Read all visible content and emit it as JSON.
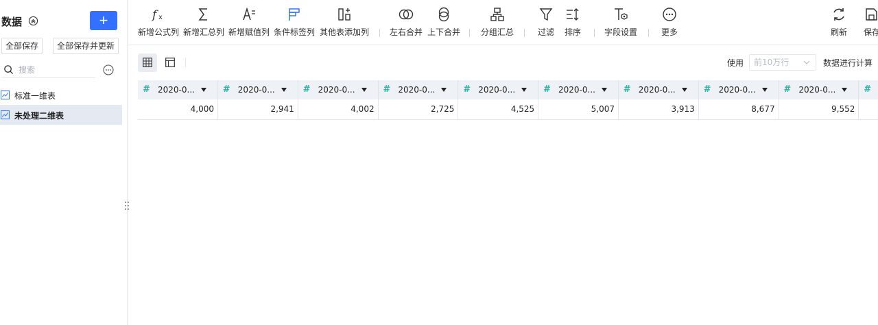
{
  "sidebar": {
    "title": "数据",
    "add_label": "+",
    "save_all": "全部保存",
    "save_all_update": "全部保存并更新",
    "search_placeholder": "搜索",
    "items": [
      {
        "label": "标准一维表"
      },
      {
        "label": "未处理二维表"
      }
    ]
  },
  "toolbar": {
    "tools": [
      {
        "label": "新增公式列",
        "icon": "formula-icon"
      },
      {
        "label": "新增汇总列",
        "icon": "sigma-icon"
      },
      {
        "label": "新增赋值列",
        "icon": "assign-icon"
      },
      {
        "label": "条件标签列",
        "icon": "condition-tag-icon"
      },
      {
        "label": "其他表添加列",
        "icon": "add-column-icon"
      },
      {
        "label": "左右合并",
        "icon": "merge-horizontal-icon"
      },
      {
        "label": "上下合并",
        "icon": "merge-vertical-icon"
      },
      {
        "label": "分组汇总",
        "icon": "group-summary-icon"
      },
      {
        "label": "过滤",
        "icon": "filter-icon"
      },
      {
        "label": "排序",
        "icon": "sort-icon"
      },
      {
        "label": "字段设置",
        "icon": "field-settings-icon"
      },
      {
        "label": "更多",
        "icon": "more-icon"
      },
      {
        "label": "刷新",
        "icon": "refresh-icon"
      },
      {
        "label": "保存",
        "icon": "save-icon"
      }
    ]
  },
  "subbar": {
    "use_label": "使用",
    "rows_value": "前10万行",
    "calc_label": "数据进行计算"
  },
  "table": {
    "columns": [
      "2020-0...",
      "2020-0...",
      "2020-0...",
      "2020-0...",
      "2020-0...",
      "2020-0...",
      "2020-0...",
      "2020-0...",
      "2020-0..."
    ],
    "rows": [
      [
        "4,000",
        "2,941",
        "4,002",
        "2,725",
        "4,525",
        "5,007",
        "3,913",
        "8,677",
        "9,552"
      ]
    ]
  },
  "colors": {
    "accent": "#3370ff",
    "number_type": "#2bb3a3",
    "header_bg": "#eef1f5",
    "selected_item_bg": "#e5e9f2"
  }
}
